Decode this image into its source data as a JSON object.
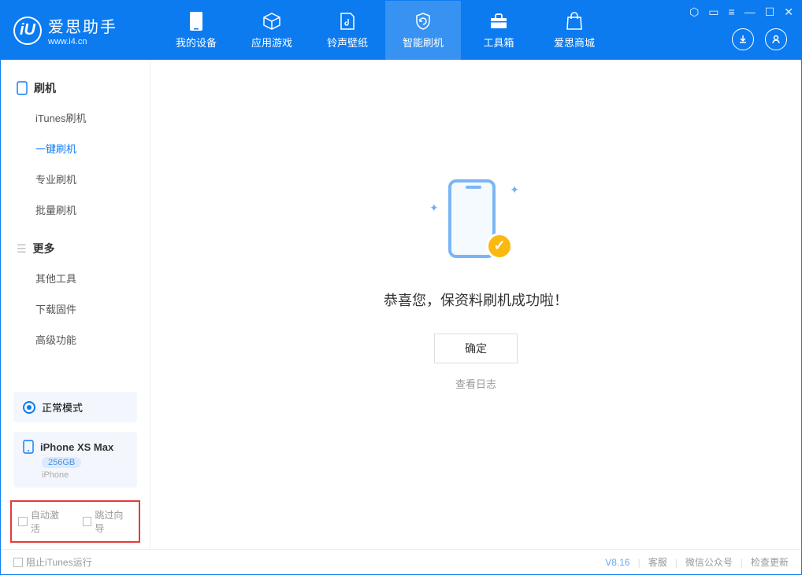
{
  "header": {
    "app_name": "爱思助手",
    "site": "www.i4.cn",
    "nav": [
      {
        "label": "我的设备"
      },
      {
        "label": "应用游戏"
      },
      {
        "label": "铃声壁纸"
      },
      {
        "label": "智能刷机"
      },
      {
        "label": "工具箱"
      },
      {
        "label": "爱思商城"
      }
    ]
  },
  "sidebar": {
    "section1_title": "刷机",
    "items1": [
      "iTunes刷机",
      "一键刷机",
      "专业刷机",
      "批量刷机"
    ],
    "section2_title": "更多",
    "items2": [
      "其他工具",
      "下载固件",
      "高级功能"
    ],
    "mode": "正常模式",
    "device_name": "iPhone XS Max",
    "device_capacity": "256GB",
    "device_type": "iPhone",
    "checkbox1": "自动激活",
    "checkbox2": "跳过向导"
  },
  "main": {
    "success_text": "恭喜您，保资料刷机成功啦！",
    "ok_button": "确定",
    "log_link": "查看日志"
  },
  "footer": {
    "block_itunes": "阻止iTunes运行",
    "version": "V8.16",
    "links": [
      "客服",
      "微信公众号",
      "检查更新"
    ]
  }
}
